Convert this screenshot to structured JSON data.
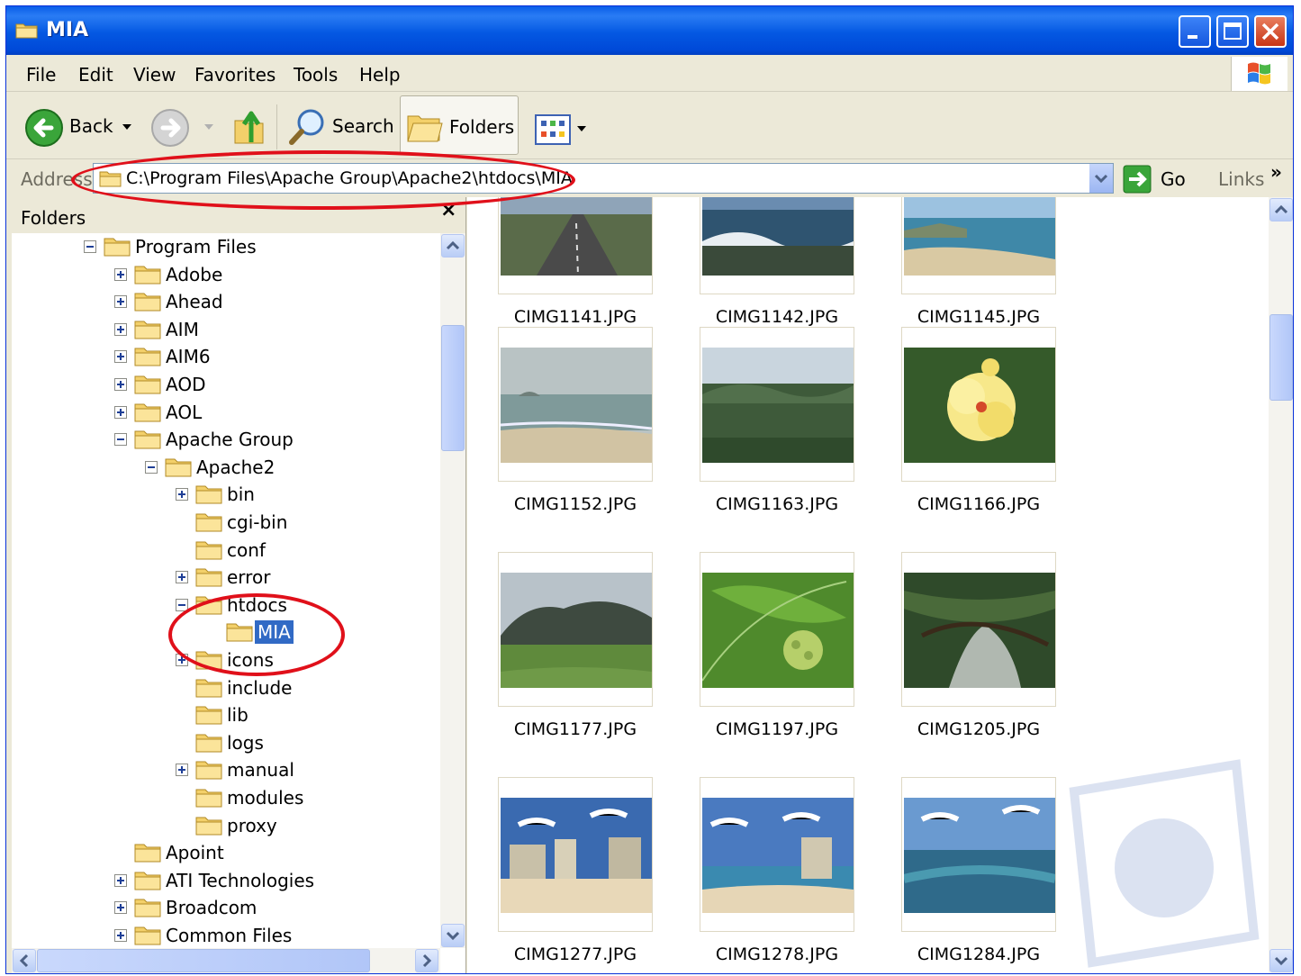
{
  "window": {
    "title": "MIA"
  },
  "menu": [
    "File",
    "Edit",
    "View",
    "Favorites",
    "Tools",
    "Help"
  ],
  "toolbar": {
    "back": "Back",
    "search": "Search",
    "folders": "Folders"
  },
  "address": {
    "label": "Address",
    "path": "C:\\Program Files\\Apache Group\\Apache2\\htdocs\\MIA",
    "go": "Go",
    "links": "Links"
  },
  "folders_pane": {
    "title": "Folders",
    "tree": [
      {
        "label": "Program Files",
        "expander": "minus"
      },
      {
        "label": "Adobe",
        "expander": "plus"
      },
      {
        "label": "Ahead",
        "expander": "plus"
      },
      {
        "label": "AIM",
        "expander": "plus"
      },
      {
        "label": "AIM6",
        "expander": "plus"
      },
      {
        "label": "AOD",
        "expander": "plus"
      },
      {
        "label": "AOL",
        "expander": "plus"
      },
      {
        "label": "Apache Group",
        "expander": "minus"
      },
      {
        "label": "Apache2",
        "expander": "minus"
      },
      {
        "label": "bin",
        "expander": "plus"
      },
      {
        "label": "cgi-bin",
        "expander": "none"
      },
      {
        "label": "conf",
        "expander": "none"
      },
      {
        "label": "error",
        "expander": "plus"
      },
      {
        "label": "htdocs",
        "expander": "minus"
      },
      {
        "label": "MIA",
        "expander": "none",
        "selected": true
      },
      {
        "label": "icons",
        "expander": "plus"
      },
      {
        "label": "include",
        "expander": "none"
      },
      {
        "label": "lib",
        "expander": "none"
      },
      {
        "label": "logs",
        "expander": "none"
      },
      {
        "label": "manual",
        "expander": "plus"
      },
      {
        "label": "modules",
        "expander": "none"
      },
      {
        "label": "proxy",
        "expander": "none"
      },
      {
        "label": "Apoint",
        "expander": "none"
      },
      {
        "label": "ATI Technologies",
        "expander": "plus"
      },
      {
        "label": "Broadcom",
        "expander": "plus"
      },
      {
        "label": "Common Files",
        "expander": "plus"
      }
    ]
  },
  "files": [
    {
      "name": "CIMG1141.JPG",
      "scene": "road"
    },
    {
      "name": "CIMG1142.JPG",
      "scene": "surf"
    },
    {
      "name": "CIMG1145.JPG",
      "scene": "coast"
    },
    {
      "name": "CIMG1152.JPG",
      "scene": "beach-grey"
    },
    {
      "name": "CIMG1163.JPG",
      "scene": "valley"
    },
    {
      "name": "CIMG1166.JPG",
      "scene": "hibiscus"
    },
    {
      "name": "CIMG1177.JPG",
      "scene": "mountain"
    },
    {
      "name": "CIMG1197.JPG",
      "scene": "noni"
    },
    {
      "name": "CIMG1205.JPG",
      "scene": "stream"
    },
    {
      "name": "CIMG1277.JPG",
      "scene": "hotel-beach"
    },
    {
      "name": "CIMG1278.JPG",
      "scene": "hotel-shore"
    },
    {
      "name": "CIMG1284.JPG",
      "scene": "reef"
    }
  ],
  "colors": {
    "titlebar": "#0458e2",
    "selection": "#316ac5",
    "annotation": "#e0101a"
  }
}
